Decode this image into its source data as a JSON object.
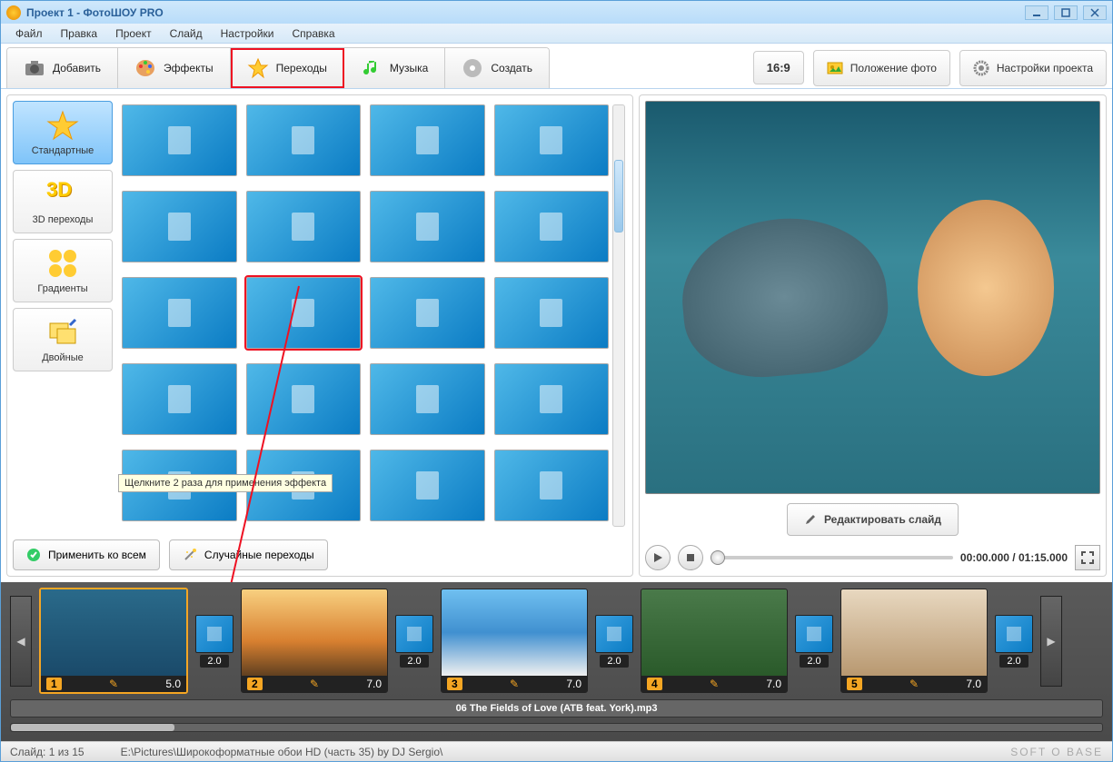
{
  "title": "Проект 1 - ФотоШОУ PRO",
  "menu": {
    "file": "Файл",
    "edit": "Правка",
    "project": "Проект",
    "slide": "Слайд",
    "settings": "Настройки",
    "help": "Справка"
  },
  "tabs": {
    "add": "Добавить",
    "effects": "Эффекты",
    "transitions": "Переходы",
    "music": "Музыка",
    "create": "Создать"
  },
  "aspect": "16:9",
  "rightTools": {
    "photoPos": "Положение фото",
    "projSettings": "Настройки проекта"
  },
  "categories": {
    "standard": "Стандартные",
    "threeD": "3D переходы",
    "gradients": "Градиенты",
    "double": "Двойные"
  },
  "tooltip": "Щелкните 2 раза для применения эффекта",
  "actions": {
    "applyAll": "Применить ко всем",
    "random": "Случайные переходы"
  },
  "editSlide": "Редактировать слайд",
  "time": "00:00.000 / 01:15.000",
  "slides": [
    {
      "num": "1",
      "dur": "5.0"
    },
    {
      "num": "2",
      "dur": "7.0"
    },
    {
      "num": "3",
      "dur": "7.0"
    },
    {
      "num": "4",
      "dur": "7.0"
    },
    {
      "num": "5",
      "dur": "7.0"
    }
  ],
  "transDur": "2.0",
  "audioTrack": "06 The Fields of Love (ATB feat. York).mp3",
  "status": {
    "slide": "Слайд: 1 из 15",
    "path": "E:\\Pictures\\Широкоформатные обои HD (часть 35) by DJ Sergio\\",
    "brand": "SOFT O BASE"
  }
}
